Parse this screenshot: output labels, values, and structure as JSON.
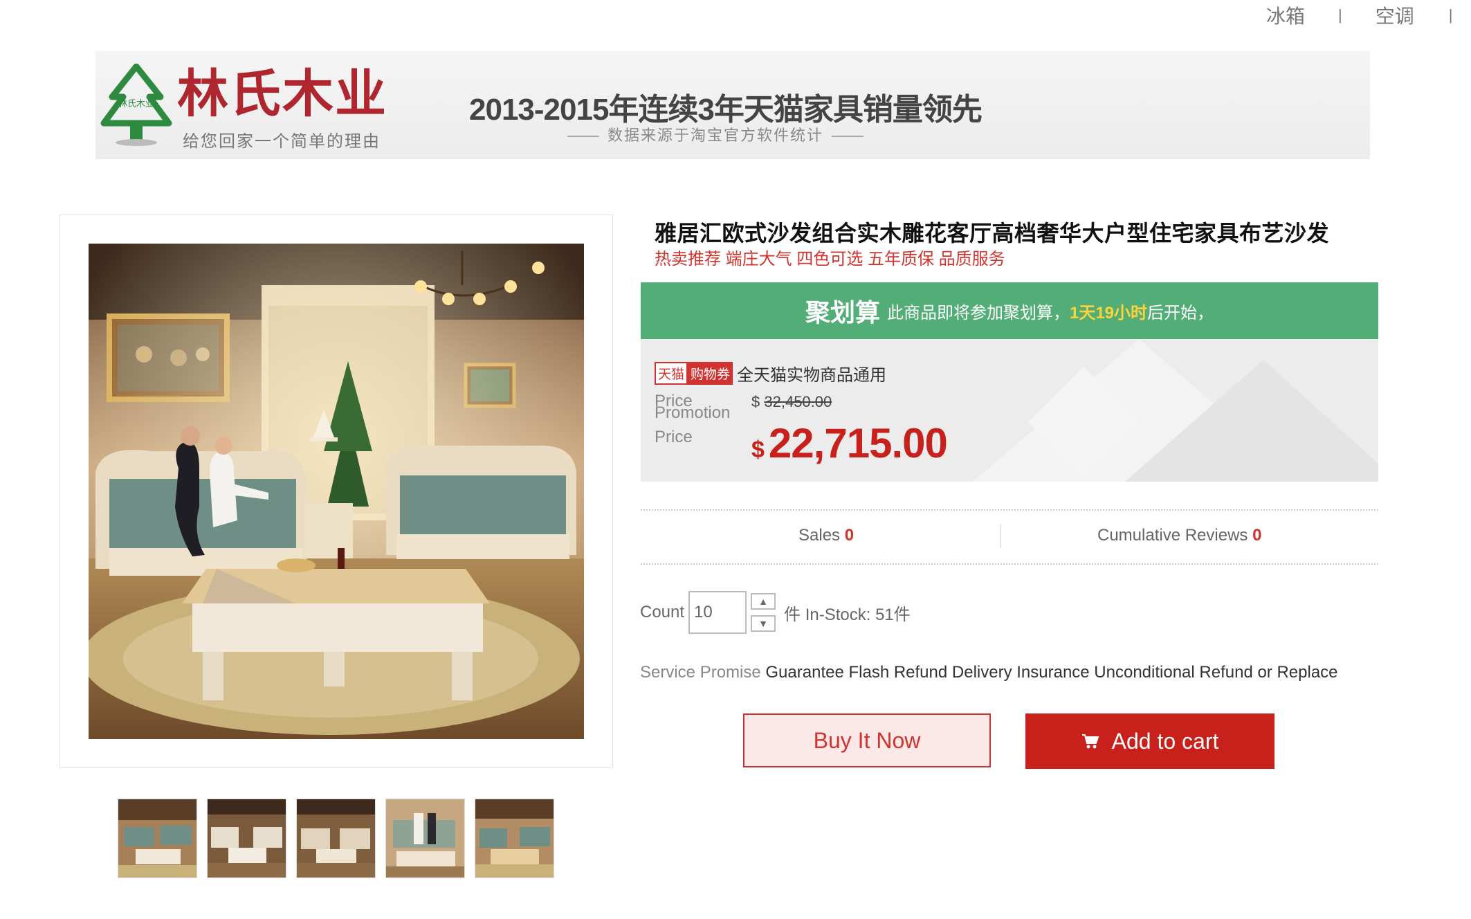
{
  "topnav": {
    "items": [
      "冰箱",
      "|",
      "空调",
      "|"
    ]
  },
  "banner": {
    "logo_title": "林氏木业",
    "logo_sub": "给您回家一个简单的理由",
    "logo_tree_text": "林氏木业",
    "headline": "2013-2015年连续3年天猫家具销量领先",
    "subline": "数据来源于淘宝官方软件统计"
  },
  "product": {
    "title": "雅居汇欧式沙发组合实木雕花客厅高档奢华大户型住宅家具布艺沙发",
    "subtitle": "热卖推荐 端庄大气 四色可选 五年质保 品质服务",
    "promo": {
      "big": "聚划算",
      "text": "此商品即将参加聚划算，",
      "highlight": "1天19小时",
      "tail": "后开始，"
    },
    "coupon": {
      "tag1": "天猫",
      "tag2": "购物券",
      "text": "全天猫实物商品通用"
    },
    "price_label": "Price",
    "promo_label_1": "Promotion",
    "promo_label_2": "Price",
    "currency": "$",
    "original_price": "32,450.00",
    "promo_price": "22,715.00",
    "sales_label": "Sales",
    "sales_value": "0",
    "reviews_label": "Cumulative Reviews",
    "reviews_value": "0",
    "count_label": "Count",
    "count_value": "10",
    "stock_text": "件 In-Stock: 51件",
    "service_label": "Service Promise",
    "service_text": "Guarantee Flash Refund Delivery Insurance Unconditional Refund or Replace",
    "buy_now": "Buy It Now",
    "add_to_cart": "Add to cart"
  },
  "icons": {
    "cart": "cart-icon",
    "up": "chevron-up-icon",
    "down": "chevron-down-icon"
  },
  "colors": {
    "accent_red": "#c8201b",
    "promo_green": "#53ad77",
    "highlight_yellow": "#ffd23a"
  }
}
